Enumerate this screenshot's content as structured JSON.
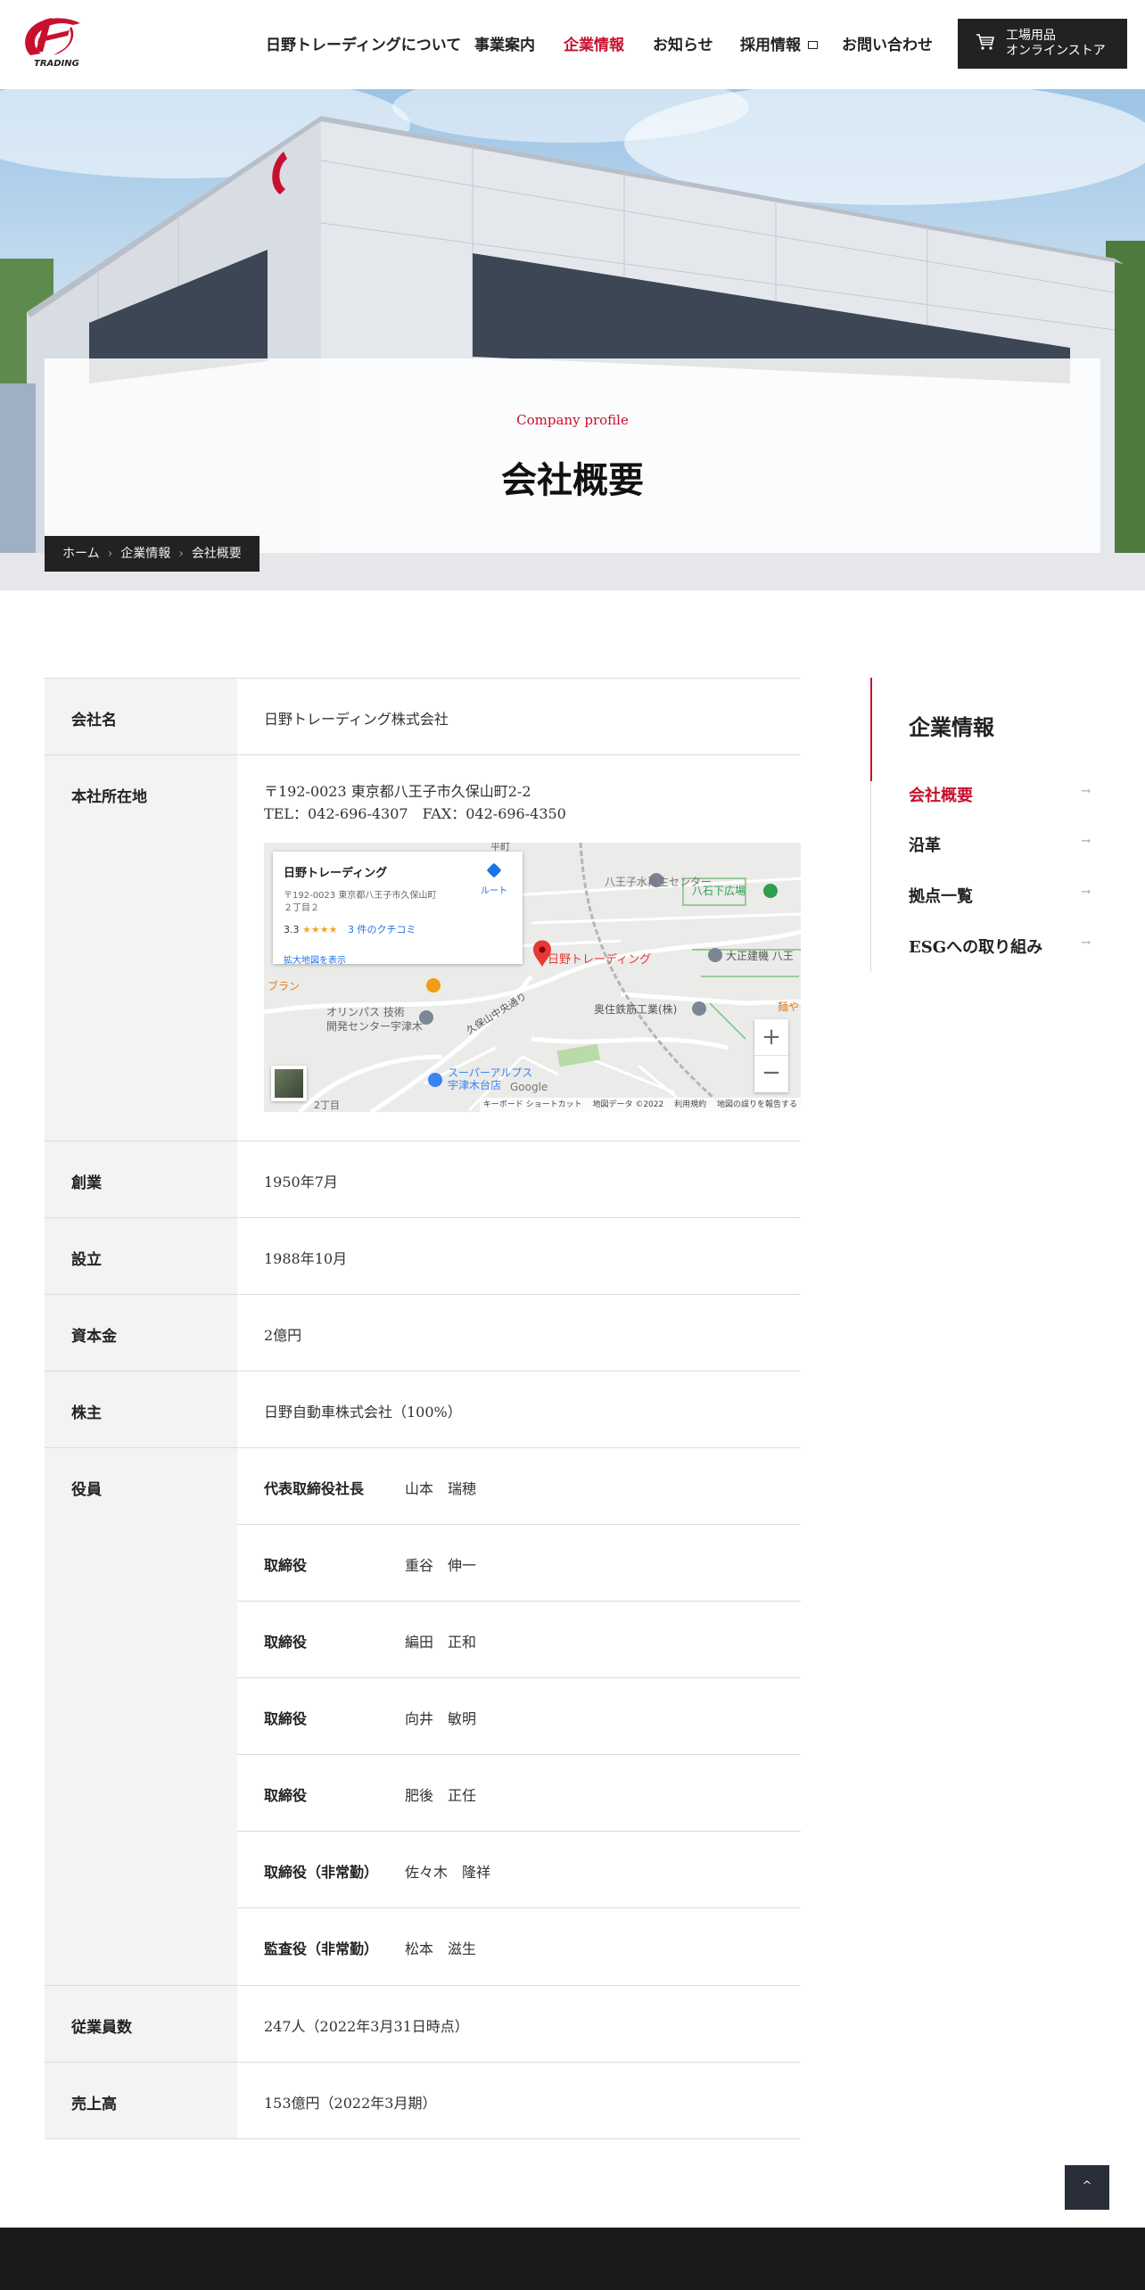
{
  "header": {
    "nav": [
      {
        "label": "日野トレーディングについて"
      },
      {
        "label": "事業案内"
      },
      {
        "label": "企業情報"
      },
      {
        "label": "お知らせ"
      },
      {
        "label": "採用情報"
      },
      {
        "label": "お問い合わせ"
      }
    ],
    "shop_line1": "工場用品",
    "shop_line2": "オンラインストア",
    "logo_text": "TRADING",
    "accent_color": "#c8102e"
  },
  "hero": {
    "title_en": "Company profile",
    "title_ja": "会社概要"
  },
  "breadcrumb": [
    "ホーム",
    "企業情報",
    "会社概要"
  ],
  "table": {
    "rows": [
      {
        "label": "会社名",
        "value": "日野トレーディング株式会社"
      },
      {
        "label": "本社所在地",
        "value": "〒192-0023 東京都八王子市久保山町2-2",
        "value2": "TEL：042-696-4307　FAX：042-696-4350"
      },
      {
        "label": "創業",
        "value": "1950年7月"
      },
      {
        "label": "設立",
        "value": "1988年10月"
      },
      {
        "label": "資本金",
        "value": "2億円"
      },
      {
        "label": "株主",
        "value": "日野自動車株式会社（100%）"
      },
      {
        "label": "役員"
      },
      {
        "label": "従業員数",
        "value": "247人（2022年3月31日時点）"
      },
      {
        "label": "売上高",
        "value": "153億円（2022年3月期）"
      }
    ],
    "officers": [
      {
        "role": "代表取締役社長",
        "name": "山本　瑞穂"
      },
      {
        "role": "取締役",
        "name": "重谷　伸一"
      },
      {
        "role": "取締役",
        "name": "編田　正和"
      },
      {
        "role": "取締役",
        "name": "向井　敏明"
      },
      {
        "role": "取締役",
        "name": "肥後　正任"
      },
      {
        "role": "取締役（非常勤）",
        "name": "佐々木　隆祥"
      },
      {
        "role": "監査役（非常勤）",
        "name": "松本　滋生"
      }
    ]
  },
  "map": {
    "place_name": "日野トレーディング",
    "address1": "〒192-0023 東京都八王子市久保山町",
    "address2": "２丁目２",
    "rating": "3.3",
    "stars": "★★★★",
    "reviews": "3 件のクチコミ",
    "route": "ルート",
    "enlarge": "拡大地図を表示",
    "pin_label": "日野トレーディング",
    "labels": [
      "平町",
      "八王子水再生センター",
      "八石下広場",
      "大正建機 八王",
      "奥住鉄筋工業(株)",
      "オリンパス 技術",
      "開発センター宇津木",
      "久保山中央通り",
      "スーパーアルプス",
      "宇津木台店",
      "ブラン",
      "麺や",
      "2丁目"
    ],
    "attribution": [
      "キーボード ショートカット",
      "地図データ ©2022",
      "利用規約",
      "地図の誤りを報告する"
    ],
    "google": "Google",
    "zoom_in": "+",
    "zoom_out": "−"
  },
  "sidebar": {
    "title": "企業情報",
    "items": [
      "会社概要",
      "沿革",
      "拠点一覧",
      "ESGへの取り組み"
    ],
    "arrow": "→"
  },
  "totop": "^"
}
